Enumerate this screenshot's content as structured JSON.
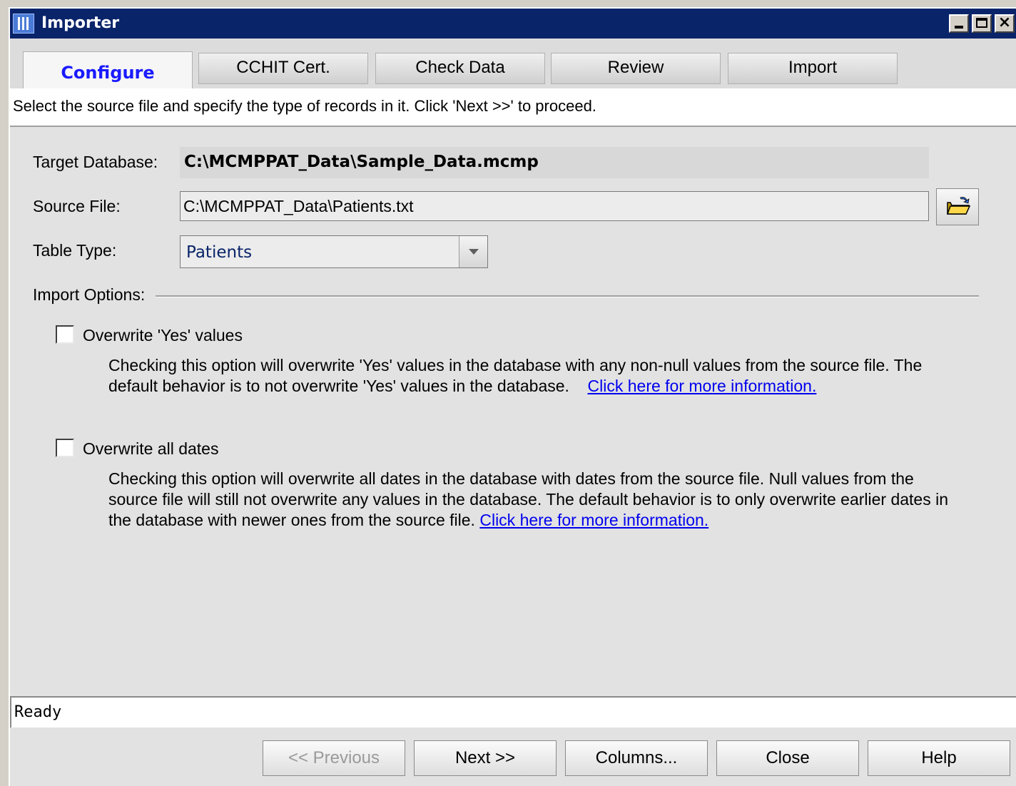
{
  "window": {
    "title": "Importer"
  },
  "tabs": [
    {
      "label": "Configure",
      "active": true
    },
    {
      "label": "CCHIT Cert.",
      "active": false
    },
    {
      "label": "Check Data",
      "active": false
    },
    {
      "label": "Review",
      "active": false
    },
    {
      "label": "Import",
      "active": false
    }
  ],
  "instructions": "Select the source file and specify the type of records in it.  Click 'Next >>' to proceed.",
  "form": {
    "target_db_label": "Target Database:",
    "target_db_value": "C:\\MCMPPAT_Data\\Sample_Data.mcmp",
    "source_label": "Source File:",
    "source_value": "C:\\MCMPPAT_Data\\Patients.txt",
    "table_type_label": "Table Type:",
    "table_type_value": "Patients",
    "import_options_label": "Import Options:"
  },
  "options": [
    {
      "label": "Overwrite 'Yes' values",
      "checked": false,
      "description": "Checking this option will overwrite 'Yes' values in the database with any non-null values from the source file. The default behavior is to not overwrite 'Yes' values in the database.",
      "link": "Click here for more information."
    },
    {
      "label": "Overwrite all dates",
      "checked": false,
      "description": "Checking this option will overwrite all dates in the database with dates from the source file.  Null values from the source file will still not overwrite any values in the database.  The default behavior is to only overwrite earlier dates in the database with newer ones from the source file.",
      "link": "Click here for more information."
    }
  ],
  "status": "Ready",
  "buttons": {
    "previous": "<< Previous",
    "next": "Next >>",
    "columns": "Columns...",
    "close": "Close",
    "help": "Help"
  },
  "icons": {
    "app": "importer-app-icon",
    "browse": "open-folder-icon",
    "dropdown": "chevron-down-icon"
  },
  "colors": {
    "titlebar": "#0a246a",
    "active_tab_text": "#1a1aff",
    "link": "#0000ee"
  }
}
